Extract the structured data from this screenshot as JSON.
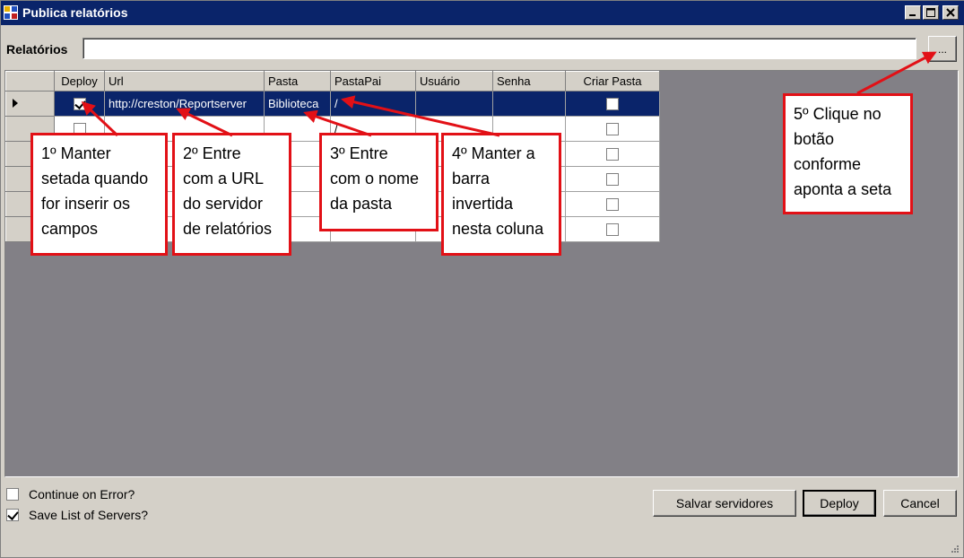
{
  "window": {
    "title": "Publica relatórios"
  },
  "relatorios": {
    "label": "Relatórios",
    "value": "",
    "browse_label": "..."
  },
  "grid": {
    "columns": [
      "Deploy",
      "Url",
      "Pasta",
      "PastaPai",
      "Usuário",
      "Senha",
      "Criar Pasta"
    ],
    "rows": [
      {
        "deploy": true,
        "url": "http://creston/Reportserver",
        "pasta": "Biblioteca",
        "pastapai": "/",
        "usuario": "",
        "senha": "",
        "criar_pasta": false,
        "selected": true
      },
      {
        "deploy": false,
        "url": "",
        "pasta": "",
        "pastapai": "/",
        "usuario": "",
        "senha": "",
        "criar_pasta": false,
        "selected": false
      },
      {
        "deploy": false,
        "url": "",
        "pasta": "",
        "pastapai": "",
        "usuario": "",
        "senha": "",
        "criar_pasta": false,
        "selected": false
      },
      {
        "deploy": false,
        "url": "",
        "pasta": "",
        "pastapai": "",
        "usuario": "",
        "senha": "",
        "criar_pasta": false,
        "selected": false
      },
      {
        "deploy": false,
        "url": "",
        "pasta": "",
        "pastapai": "",
        "usuario": "",
        "senha": "",
        "criar_pasta": false,
        "selected": false
      },
      {
        "deploy": false,
        "url": "",
        "pasta": "",
        "pastapai": "",
        "usuario": "",
        "senha": "",
        "criar_pasta": false,
        "selected": false
      }
    ]
  },
  "callouts": {
    "c1": [
      "1º Manter",
      "setada quando",
      "for inserir os",
      "campos"
    ],
    "c2": [
      "2º Entre",
      "com a URL",
      "do servidor",
      "de relatórios"
    ],
    "c3": [
      "3º Entre",
      "com o nome",
      "da pasta"
    ],
    "c4": [
      "4º Manter a",
      "barra",
      "invertida",
      "nesta coluna"
    ],
    "c5": [
      "5º Clique no",
      "botão",
      "conforme",
      "aponta a seta"
    ]
  },
  "options": {
    "continue_on_error": {
      "label": "Continue on Error?",
      "checked": false
    },
    "save_list": {
      "label": "Save List of Servers?",
      "checked": true
    }
  },
  "buttons": {
    "salvar": "Salvar servidores",
    "deploy": "Deploy",
    "cancel": "Cancel"
  },
  "colors": {
    "titlebar": "#0a246a",
    "callout_border": "#e21016",
    "grid_background": "#828086"
  }
}
